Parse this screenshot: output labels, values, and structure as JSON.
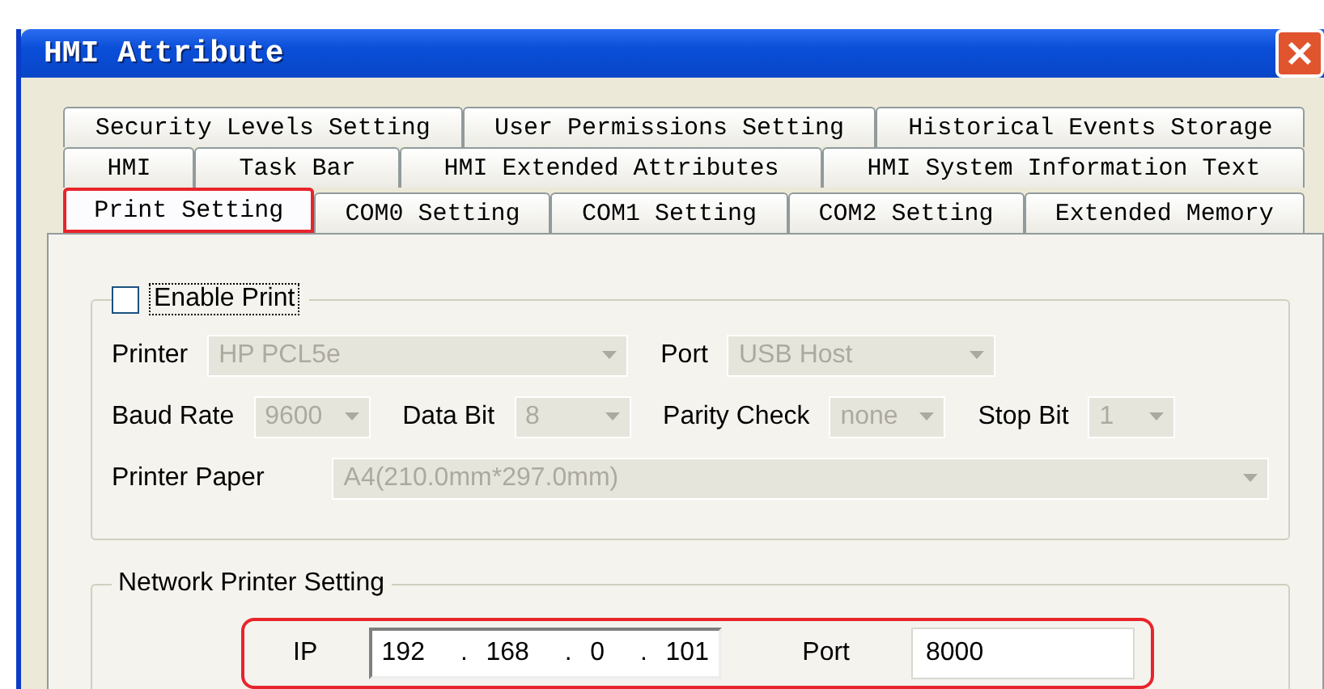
{
  "window": {
    "title": "HMI Attribute"
  },
  "tab_rows": [
    [
      {
        "label": "Security Levels Setting",
        "selected": false,
        "highlighted": false
      },
      {
        "label": "User Permissions Setting",
        "selected": false,
        "highlighted": false
      },
      {
        "label": "Historical Events Storage",
        "selected": false,
        "highlighted": false
      }
    ],
    [
      {
        "label": "HMI",
        "selected": false,
        "highlighted": false
      },
      {
        "label": "Task Bar",
        "selected": false,
        "highlighted": false
      },
      {
        "label": "HMI Extended Attributes",
        "selected": false,
        "highlighted": false
      },
      {
        "label": "HMI System Information Text",
        "selected": false,
        "highlighted": false
      }
    ],
    [
      {
        "label": "Print Setting",
        "selected": true,
        "highlighted": true
      },
      {
        "label": "COM0 Setting",
        "selected": false,
        "highlighted": false
      },
      {
        "label": "COM1 Setting",
        "selected": false,
        "highlighted": false
      },
      {
        "label": "COM2 Setting",
        "selected": false,
        "highlighted": false
      },
      {
        "label": "Extended Memory",
        "selected": false,
        "highlighted": false
      }
    ]
  ],
  "print_group": {
    "enable_print": {
      "label": "Enable Print",
      "checked": false
    },
    "printer": {
      "label": "Printer",
      "value": "HP PCL5e"
    },
    "port": {
      "label": "Port",
      "value": "USB Host"
    },
    "baud_rate": {
      "label": "Baud Rate",
      "value": "9600"
    },
    "data_bit": {
      "label": "Data Bit",
      "value": "8"
    },
    "parity_check": {
      "label": "Parity Check",
      "value": "none"
    },
    "stop_bit": {
      "label": "Stop Bit",
      "value": "1"
    },
    "printer_paper": {
      "label": "Printer Paper",
      "value": "A4(210.0mm*297.0mm)"
    }
  },
  "network_group": {
    "title": "Network Printer Setting",
    "highlighted": true,
    "ip_label": "IP",
    "ip": [
      "192",
      "168",
      "0",
      "101"
    ],
    "ip_separator": ".",
    "port_label": "Port",
    "port": "8000"
  }
}
